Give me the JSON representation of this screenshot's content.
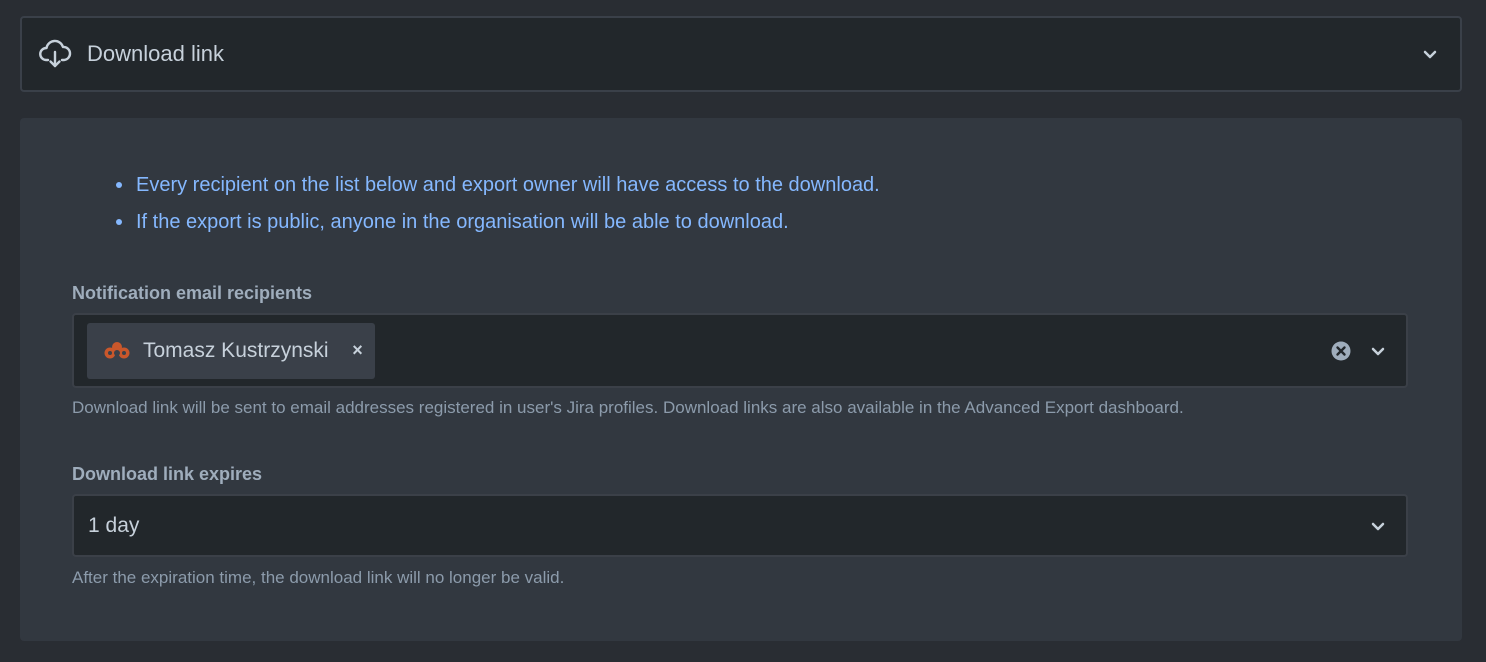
{
  "header": {
    "icon": "cloud-download-icon",
    "title": "Download link",
    "chevron_icon": "chevron-down-icon"
  },
  "info": {
    "items": [
      "Every recipient on the list below and export owner will have access to the download.",
      "If the export is public, anyone in the organisation will be able to download."
    ],
    "color": "#85b8ff"
  },
  "recipients": {
    "label": "Notification email recipients",
    "selected": [
      {
        "name": "Tomasz Kustrzynski",
        "avatar": "user-avatar-icon",
        "remove_icon": "×"
      }
    ],
    "clear_icon": "clear-circle-icon",
    "chevron_icon": "chevron-down-icon",
    "help": "Download link will be sent to email addresses registered in user's Jira profiles. Download links are also available in the Advanced Export dashboard."
  },
  "expiry": {
    "label": "Download link expires",
    "value": "1 day",
    "chevron_icon": "chevron-down-icon",
    "help": "After the expiration time, the download link will no longer be valid."
  },
  "colors": {
    "page_bg": "#292d33",
    "panel_bg": "#323840",
    "input_bg": "#22272b",
    "avatar": "#c9572b"
  }
}
